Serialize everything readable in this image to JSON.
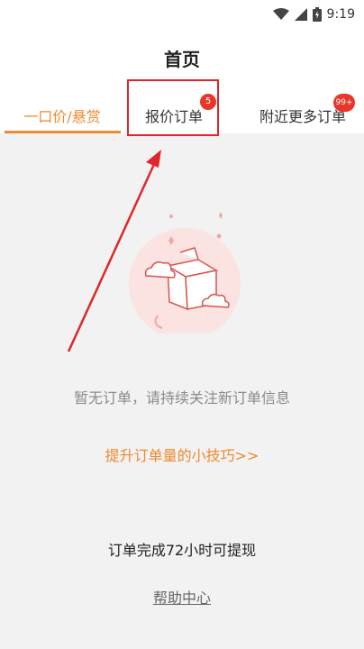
{
  "status_bar": {
    "time": "9:19",
    "icons": [
      "wifi-icon",
      "signal-icon",
      "battery-icon"
    ]
  },
  "header": {
    "title": "首页"
  },
  "tabs": [
    {
      "label": "一口价/悬赏",
      "badge": ""
    },
    {
      "label": "报价订单",
      "badge": "5"
    },
    {
      "label": "附近更多订单",
      "badge": "99+"
    }
  ],
  "empty_state": {
    "message": "暂无订单，请持续关注新订单信息"
  },
  "tips_link": "提升订单量的小技巧>>",
  "notice": "订单完成72小时可提现",
  "help_link": "帮助中心",
  "colors": {
    "accent": "#f0892f",
    "badge": "#e8372a",
    "annotation": "#e0262a"
  }
}
